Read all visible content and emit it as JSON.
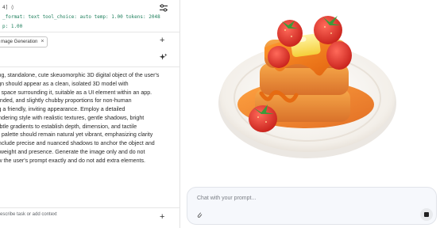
{
  "settings": {
    "line1": "4] ◊",
    "line2": "_format: text tool_choice: auto temp: 1.00 tokens: 2048",
    "line3": "p: 1.00"
  },
  "system_instruction": {
    "chip_label": "mage Generation",
    "body_lines": [
      "ping, standalone, cute skeuomorphic 3D digital object of the user's",
      "sign should appear as a clean, isolated 3D model with",
      "ite space surrounding it, suitable as a UI element within an app.",
      "ounded, and slightly chubby proportions for non-human",
      "ing a friendly, inviting appearance. Employ a detailed",
      "rendering style with realistic textures, gentle shadows, bright",
      "subtle gradients to establish depth, dimension, and tactile",
      "lor palette should remain natural yet vibrant, emphasizing clarity",
      ". Include precise and nuanced shadows to anchor the object and",
      "of weight and presence. Generate the image only and do not",
      "low the user's prompt exactly and do not add extra elements."
    ]
  },
  "bottom_input": {
    "placeholder": "escribe task or add context"
  },
  "chat": {
    "placeholder": "Chat with your prompt..."
  },
  "icons": {
    "tune": "tune-icon",
    "add": "plus-icon",
    "sparkle": "sparkle-icon",
    "attach": "paperclip-icon",
    "send": "stop-icon"
  },
  "colors": {
    "accent_green": "#1e7f5c",
    "chat_bg": "#f6f8fc"
  }
}
